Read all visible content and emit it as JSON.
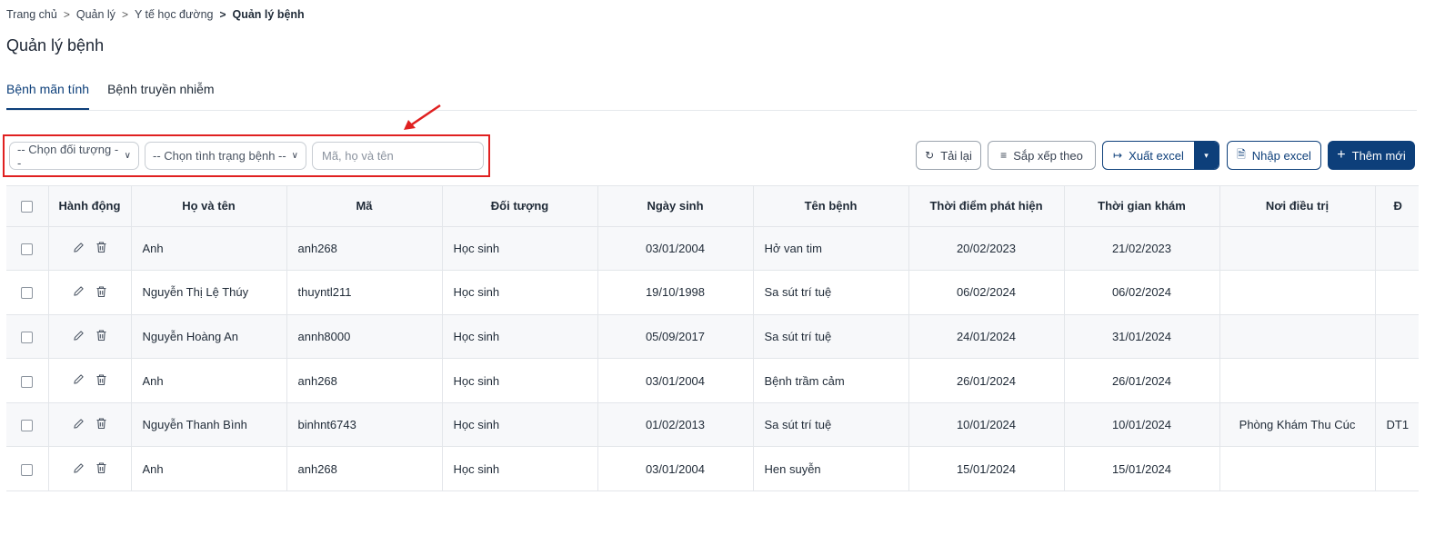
{
  "breadcrumb": [
    "Trang chủ",
    "Quản lý",
    "Y tế học đường",
    "Quản lý bệnh"
  ],
  "breadcrumb_separator": ">",
  "page_title": "Quản lý bệnh",
  "tabs": [
    {
      "label": "Bệnh mãn tính",
      "active": true
    },
    {
      "label": "Bệnh truyền nhiễm",
      "active": false
    }
  ],
  "filters": {
    "doi_tuong": "-- Chọn đối tượng --",
    "tinh_trang": "-- Chọn tình trạng bệnh --",
    "search_placeholder": "Mã, họ và tên",
    "search_value": ""
  },
  "toolbar": {
    "reload": "Tải lại",
    "sort": "Sắp xếp theo",
    "export": "Xuất excel",
    "import": "Nhập excel",
    "add": "Thêm mới"
  },
  "icons": {
    "reload": "refresh-icon",
    "sort": "sort-lines-icon",
    "export": "export-icon",
    "import": "import-file-icon",
    "add": "plus-icon",
    "edit": "pencil-icon",
    "delete": "trash-icon",
    "dropdown": "chevron-down-icon",
    "annotation": "red-arrow-icon"
  },
  "colors": {
    "primary": "#0d3f7a",
    "highlight": "#e02020",
    "border": "#e3e6ea",
    "row_alt": "#f7f8fa"
  },
  "table": {
    "columns": [
      "",
      "Hành động",
      "Họ và tên",
      "Mã",
      "Đối tượng",
      "Ngày sinh",
      "Tên bệnh",
      "Thời điểm phát hiện",
      "Thời gian khám",
      "Nơi điều trị",
      "Đ"
    ],
    "rows": [
      {
        "name": "Anh",
        "code": "anh268",
        "subject": "Học sinh",
        "dob": "03/01/2004",
        "disease": "Hở van tim",
        "detected": "20/02/2023",
        "exam": "21/02/2023",
        "place": "",
        "extra": ""
      },
      {
        "name": "Nguyễn Thị Lệ Thúy",
        "code": "thuyntl211",
        "subject": "Học sinh",
        "dob": "19/10/1998",
        "disease": "Sa sút trí tuệ",
        "detected": "06/02/2024",
        "exam": "06/02/2024",
        "place": "",
        "extra": ""
      },
      {
        "name": "Nguyễn Hoàng An",
        "code": "annh8000",
        "subject": "Học sinh",
        "dob": "05/09/2017",
        "disease": "Sa sút trí tuệ",
        "detected": "24/01/2024",
        "exam": "31/01/2024",
        "place": "",
        "extra": ""
      },
      {
        "name": "Anh",
        "code": "anh268",
        "subject": "Học sinh",
        "dob": "03/01/2004",
        "disease": "Bệnh trầm cảm",
        "detected": "26/01/2024",
        "exam": "26/01/2024",
        "place": "",
        "extra": ""
      },
      {
        "name": "Nguyễn Thanh Bình",
        "code": "binhnt6743",
        "subject": "Học sinh",
        "dob": "01/02/2013",
        "disease": "Sa sút trí tuệ",
        "detected": "10/01/2024",
        "exam": "10/01/2024",
        "place": "Phòng Khám Thu Cúc",
        "extra": "DT1"
      },
      {
        "name": "Anh",
        "code": "anh268",
        "subject": "Học sinh",
        "dob": "03/01/2004",
        "disease": "Hen suyễn",
        "detected": "15/01/2024",
        "exam": "15/01/2024",
        "place": "",
        "extra": ""
      }
    ]
  }
}
